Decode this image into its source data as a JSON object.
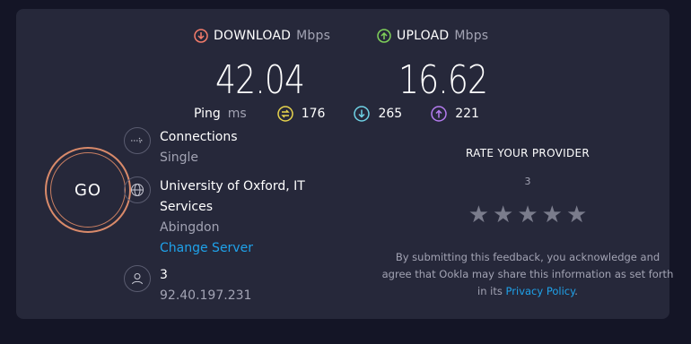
{
  "download": {
    "label": "DOWNLOAD",
    "unit": "Mbps",
    "value": "42.04",
    "color": "#f57c6b"
  },
  "upload": {
    "label": "UPLOAD",
    "unit": "Mbps",
    "value": "16.62",
    "color": "#7fd15a"
  },
  "ping": {
    "label": "Ping",
    "unit": "ms",
    "idle": "176",
    "download": "265",
    "upload": "221",
    "idle_color": "#e8d44d",
    "download_color": "#6fd3e6",
    "upload_color": "#b57cf0"
  },
  "go_button": {
    "label": "GO",
    "color": "#d98a6a"
  },
  "connections": {
    "title": "Connections",
    "value": "Single"
  },
  "server": {
    "title_line1": "University of Oxford, IT",
    "title_line2": "Services",
    "location": "Abingdon",
    "change_label": "Change Server"
  },
  "user": {
    "provider": "3",
    "ip": "92.40.197.231"
  },
  "rating": {
    "title": "RATE YOUR PROVIDER",
    "provider": "3",
    "stars": 5,
    "disclaimer_prefix": "By submitting this feedback, you acknowledge and agree that Ookla may share this information as set forth in its",
    "privacy_link": "Privacy Policy",
    "disclaimer_suffix": "."
  },
  "colors": {
    "background": "#141526",
    "card": "#26283a",
    "link": "#1fa2ea"
  }
}
